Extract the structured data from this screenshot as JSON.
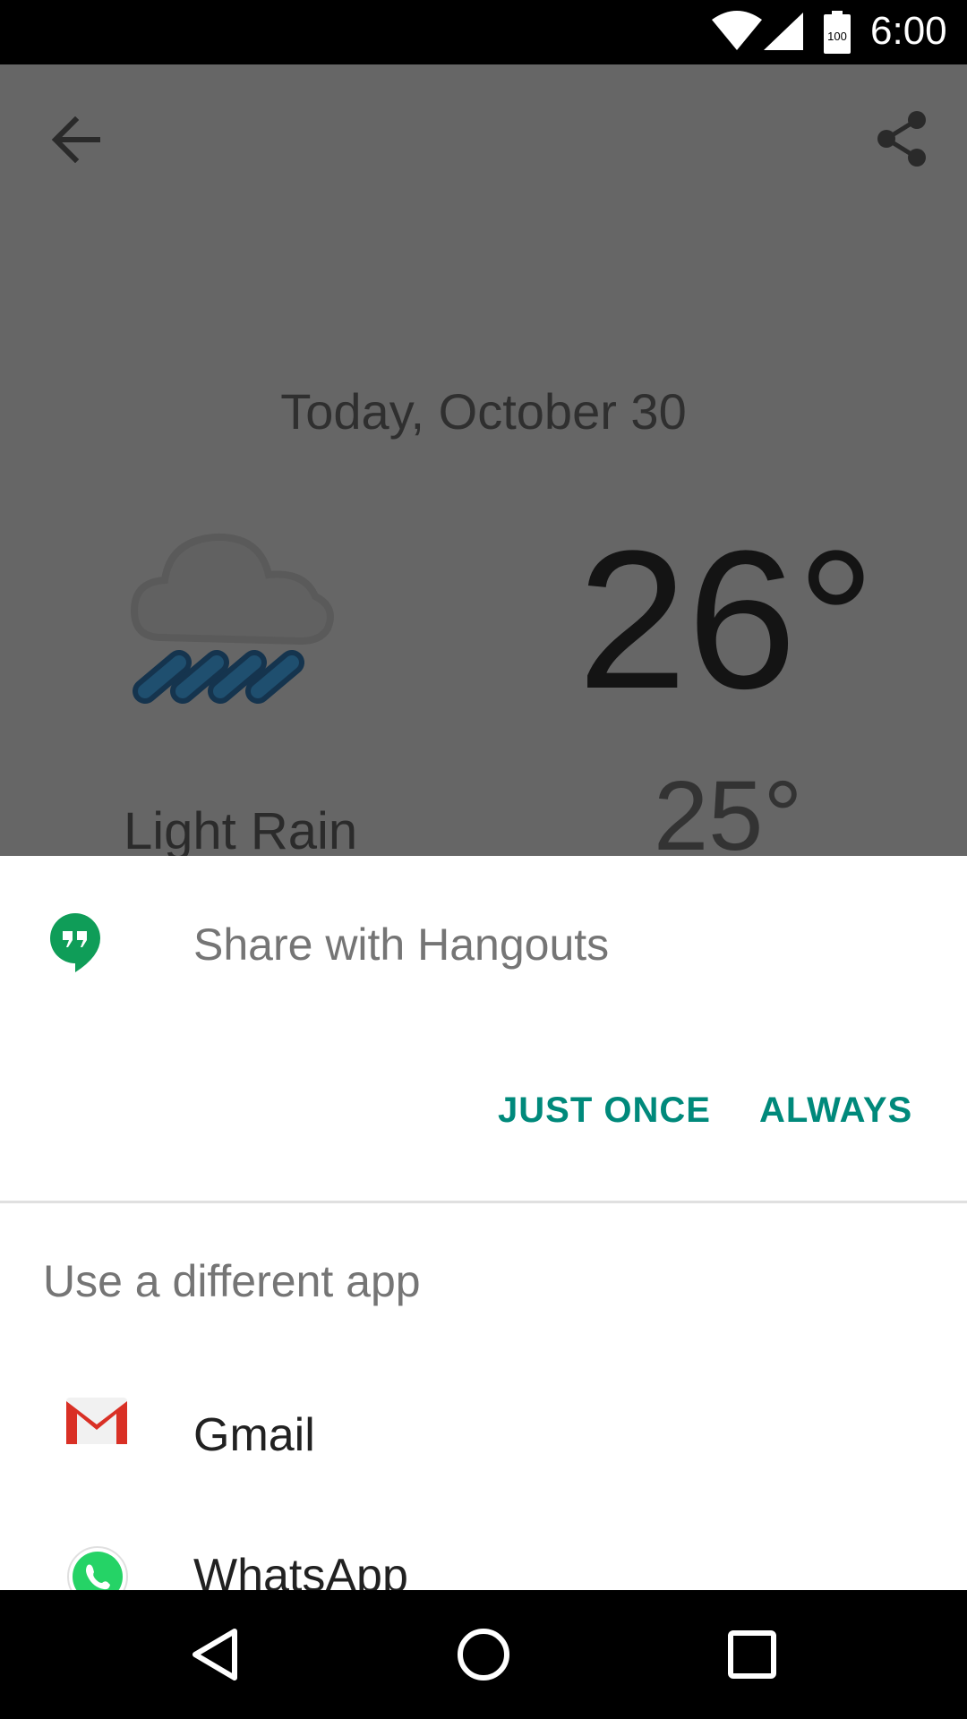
{
  "status_bar": {
    "time": "6:00",
    "battery_level": "100",
    "icons": [
      "wifi-icon",
      "signal-icon",
      "battery-icon"
    ]
  },
  "app": {
    "icons": [
      "back-arrow-icon",
      "share-icon",
      "rain-cloud-icon"
    ],
    "date": "Today, October 30",
    "temp_high": "26°",
    "temp_low": "25°",
    "condition": "Light Rain"
  },
  "share_sheet": {
    "default_app_title": "Share with Hangouts",
    "default_app_icon": "hangouts-icon",
    "just_once_label": "JUST ONCE",
    "always_label": "ALWAYS",
    "other_apps_title": "Use a different app",
    "apps": [
      {
        "label": "Gmail",
        "icon": "gmail-icon"
      },
      {
        "label": "WhatsApp",
        "icon": "whatsapp-icon"
      }
    ]
  },
  "nav_bar": {
    "icons": [
      "nav-back-icon",
      "nav-home-icon",
      "nav-recents-icon"
    ]
  },
  "colors": {
    "accent": "#00897b",
    "scrim": "#666666",
    "hangouts_green": "#0f9d58",
    "gmail_red": "#d93025",
    "whatsapp_green": "#25d366"
  }
}
